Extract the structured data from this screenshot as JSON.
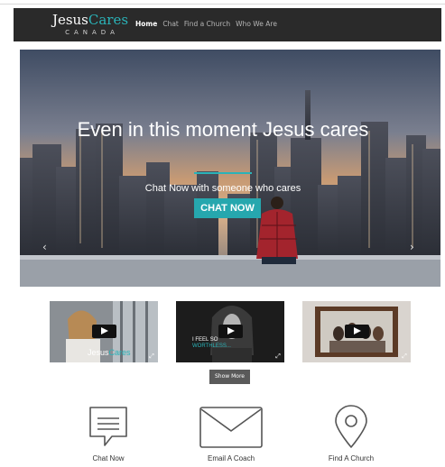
{
  "nav": {
    "logo_main": "Jesus",
    "logo_accent": "Cares",
    "logo_sub": "CANADA",
    "items": [
      {
        "label": "Home",
        "active": true
      },
      {
        "label": "Chat",
        "active": false
      },
      {
        "label": "Find a Church",
        "active": false
      },
      {
        "label": "Who We Are",
        "active": false
      }
    ]
  },
  "hero": {
    "title": "Even in this moment Jesus cares",
    "subtitle": "Chat Now with someone who cares",
    "cta_label": "CHAT NOW",
    "prev_arrow": "‹",
    "next_arrow": "›"
  },
  "videos": [
    {
      "caption_main": "Jesus",
      "caption_accent": "Cares",
      "icon": "play-icon"
    },
    {
      "caption_main": "I FEEL SO",
      "caption_accent": "WORTHLESS...",
      "icon": "play-icon"
    },
    {
      "icon": "play-icon"
    }
  ],
  "show_more_label": "Show More",
  "features": [
    {
      "label": "Chat Now",
      "icon": "chat-bubble-icon"
    },
    {
      "label": "Email A Coach",
      "icon": "envelope-icon"
    },
    {
      "label": "Find A Church",
      "icon": "map-pin-icon"
    }
  ],
  "colors": {
    "accent": "#2ab3b8",
    "nav_bg": "#2a2a2a",
    "cta_bg": "#26a7ae"
  }
}
